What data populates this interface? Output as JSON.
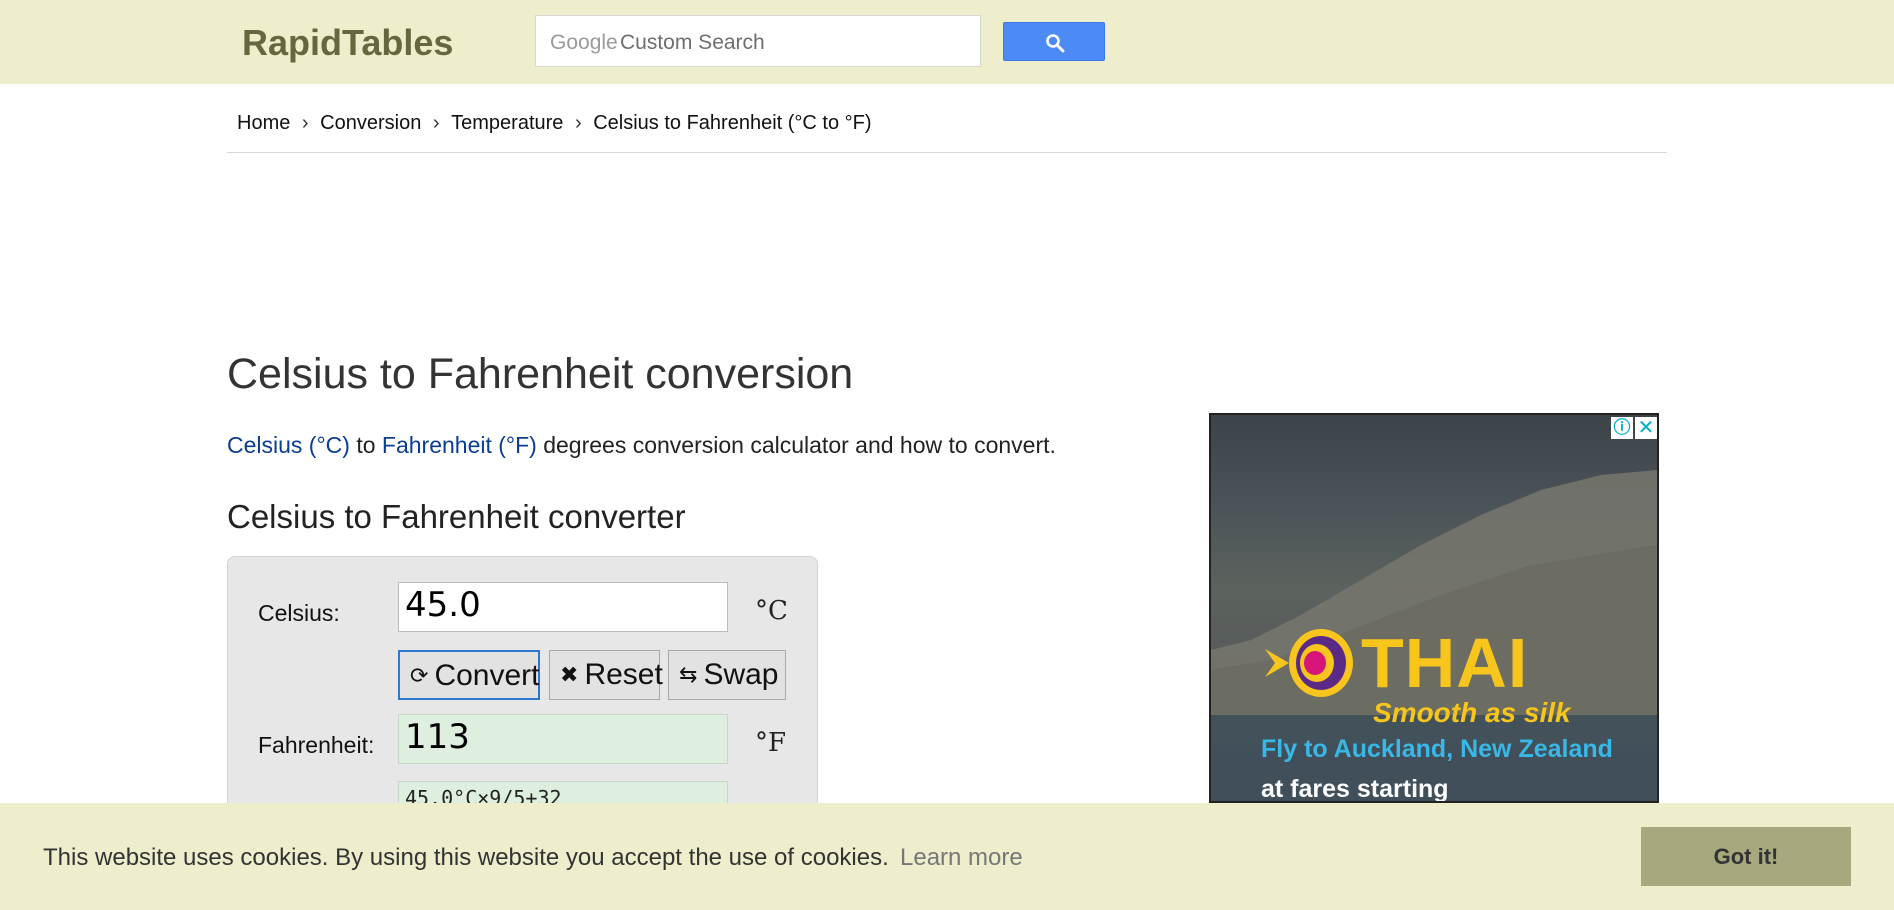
{
  "header": {
    "logo": "RapidTables",
    "search": {
      "brand": "Google",
      "placeholder": "Custom Search",
      "button_icon": "search-icon"
    }
  },
  "breadcrumb": [
    "Home",
    "Conversion",
    "Temperature",
    "Celsius to Fahrenheit (°C to °F)"
  ],
  "breadcrumb_separator": "›",
  "main": {
    "title": "Celsius to Fahrenheit conversion",
    "intro": {
      "link1": "Celsius (°C)",
      "mid": " to ",
      "link2": "Fahrenheit (°F)",
      "rest": " degrees conversion calculator and how to convert."
    },
    "converter_heading": "Celsius to Fahrenheit converter",
    "converter": {
      "celsius_label": "Celsius:",
      "celsius_value": "45.0",
      "celsius_unit": "°C",
      "convert_label": "Convert",
      "convert_icon": "refresh-icon",
      "reset_label": "Reset",
      "reset_icon": "x-icon",
      "swap_label": "Swap",
      "swap_icon": "swap-icon",
      "fahrenheit_label": "Fahrenheit:",
      "fahrenheit_value": "113",
      "fahrenheit_unit": "°F",
      "formula": "45.0°C×9/5+32"
    }
  },
  "ad": {
    "info_icon": "ⓘ",
    "close_icon": "✕",
    "brand": "THAI",
    "slogan": "Smooth as silk",
    "line1": "Fly to Auckland, New Zealand",
    "line2": "at fares starting",
    "colors": {
      "gold": "#f7c51c",
      "blue": "#39b8e6",
      "purple": "#5b2a86",
      "magenta": "#d6157b"
    }
  },
  "cookie_banner": {
    "message": "This website uses cookies. By using this website you accept the use of cookies.",
    "link": "Learn more",
    "button": "Got it!"
  },
  "colors": {
    "header_bg": "#eeeecc",
    "logo": "#66663f",
    "search_button": "#4c8bf5",
    "link": "#0b3d91",
    "result_bg": "#dfefdf"
  }
}
